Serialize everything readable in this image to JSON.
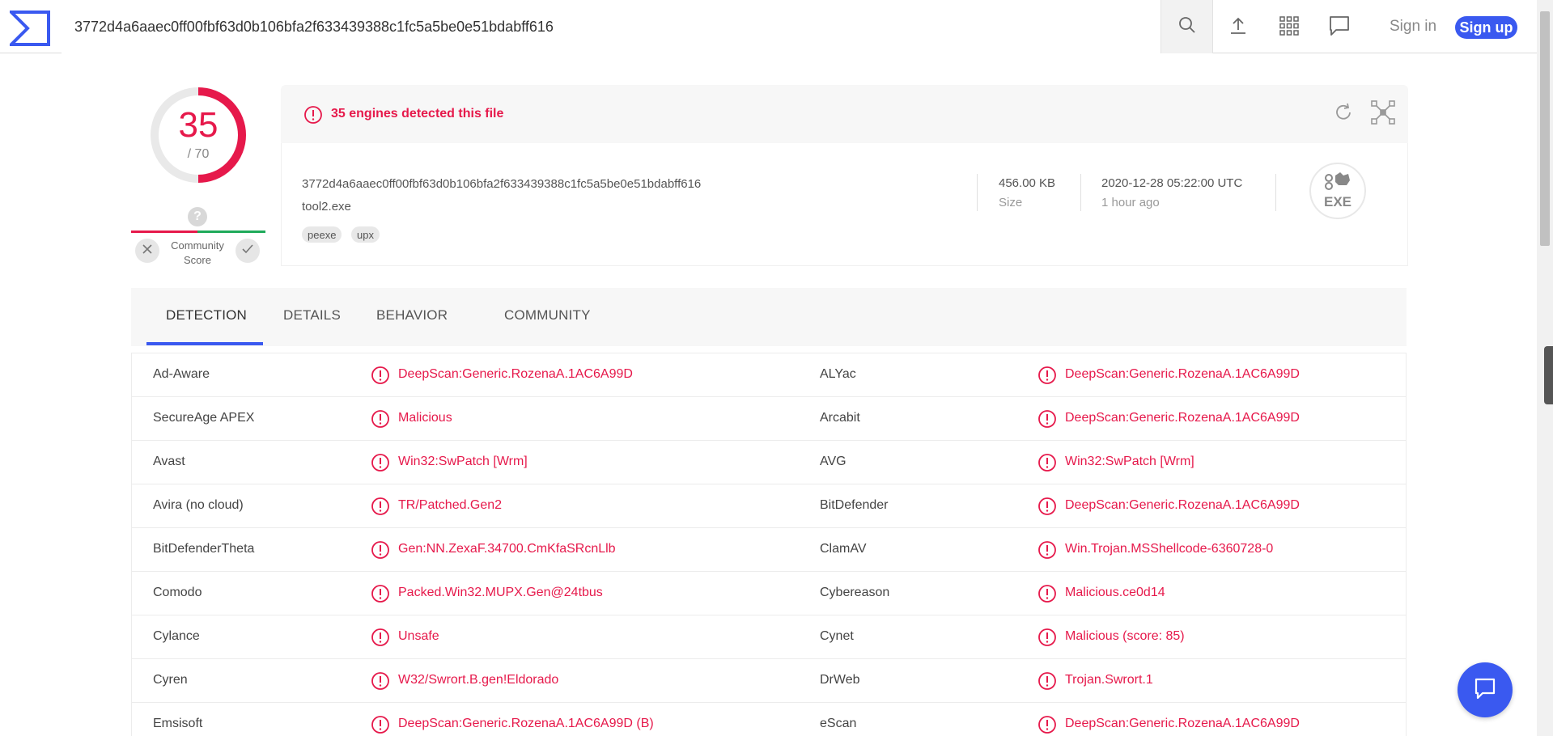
{
  "search": {
    "value": "3772d4a6aaec0ff00fbf63d0b106bfa2f633439388c1fc5a5be0e51bdabff616"
  },
  "nav": {
    "sign_in": "Sign in",
    "sign_up": "Sign up"
  },
  "icons": {
    "logo": "virustotal-logo-icon",
    "search": "search-icon",
    "upload": "upload-icon",
    "apps": "apps-grid-icon",
    "chat": "chat-icon",
    "reanalyze": "refresh-icon",
    "similar": "graph-icon",
    "alert": "exclamation-circle-icon",
    "file_type": "exe-file-icon"
  },
  "colors": {
    "accent": "#3a59f0",
    "danger": "#e6194b",
    "ok": "#1faa5a"
  },
  "score": {
    "detected": "35",
    "total": "/ 70",
    "detected_count": 35,
    "total_count": 70
  },
  "community": {
    "unknown": "?",
    "label": "Community Score"
  },
  "summary": {
    "alert": "35 engines detected this file",
    "hash": "3772d4a6aaec0ff00fbf63d0b106bfa2f633439388c1fc5a5be0e51bdabff616",
    "filename": "tool2.exe",
    "tags": [
      "peexe",
      "upx"
    ],
    "size_value": "456.00 KB",
    "size_label": "Size",
    "date_value": "2020-12-28 05:22:00 UTC",
    "date_label": "1 hour ago",
    "file_type": "EXE"
  },
  "tabs": [
    "DETECTION",
    "DETAILS",
    "BEHAVIOR",
    "COMMUNITY"
  ],
  "active_tab": "DETECTION",
  "detections": [
    {
      "left_engine": "Ad-Aware",
      "left_result": "DeepScan:Generic.RozenaA.1AC6A99D",
      "right_engine": "ALYac",
      "right_result": "DeepScan:Generic.RozenaA.1AC6A99D"
    },
    {
      "left_engine": "SecureAge APEX",
      "left_result": "Malicious",
      "right_engine": "Arcabit",
      "right_result": "DeepScan:Generic.RozenaA.1AC6A99D"
    },
    {
      "left_engine": "Avast",
      "left_result": "Win32:SwPatch [Wrm]",
      "right_engine": "AVG",
      "right_result": "Win32:SwPatch [Wrm]"
    },
    {
      "left_engine": "Avira (no cloud)",
      "left_result": "TR/Patched.Gen2",
      "right_engine": "BitDefender",
      "right_result": "DeepScan:Generic.RozenaA.1AC6A99D"
    },
    {
      "left_engine": "BitDefenderTheta",
      "left_result": "Gen:NN.ZexaF.34700.CmKfaSRcnLlb",
      "right_engine": "ClamAV",
      "right_result": "Win.Trojan.MSShellcode-6360728-0"
    },
    {
      "left_engine": "Comodo",
      "left_result": "Packed.Win32.MUPX.Gen@24tbus",
      "right_engine": "Cybereason",
      "right_result": "Malicious.ce0d14"
    },
    {
      "left_engine": "Cylance",
      "left_result": "Unsafe",
      "right_engine": "Cynet",
      "right_result": "Malicious (score: 85)"
    },
    {
      "left_engine": "Cyren",
      "left_result": "W32/Swrort.B.gen!Eldorado",
      "right_engine": "DrWeb",
      "right_result": "Trojan.Swrort.1"
    },
    {
      "left_engine": "Emsisoft",
      "left_result": "DeepScan:Generic.RozenaA.1AC6A99D (B)",
      "right_engine": "eScan",
      "right_result": "DeepScan:Generic.RozenaA.1AC6A99D"
    }
  ]
}
